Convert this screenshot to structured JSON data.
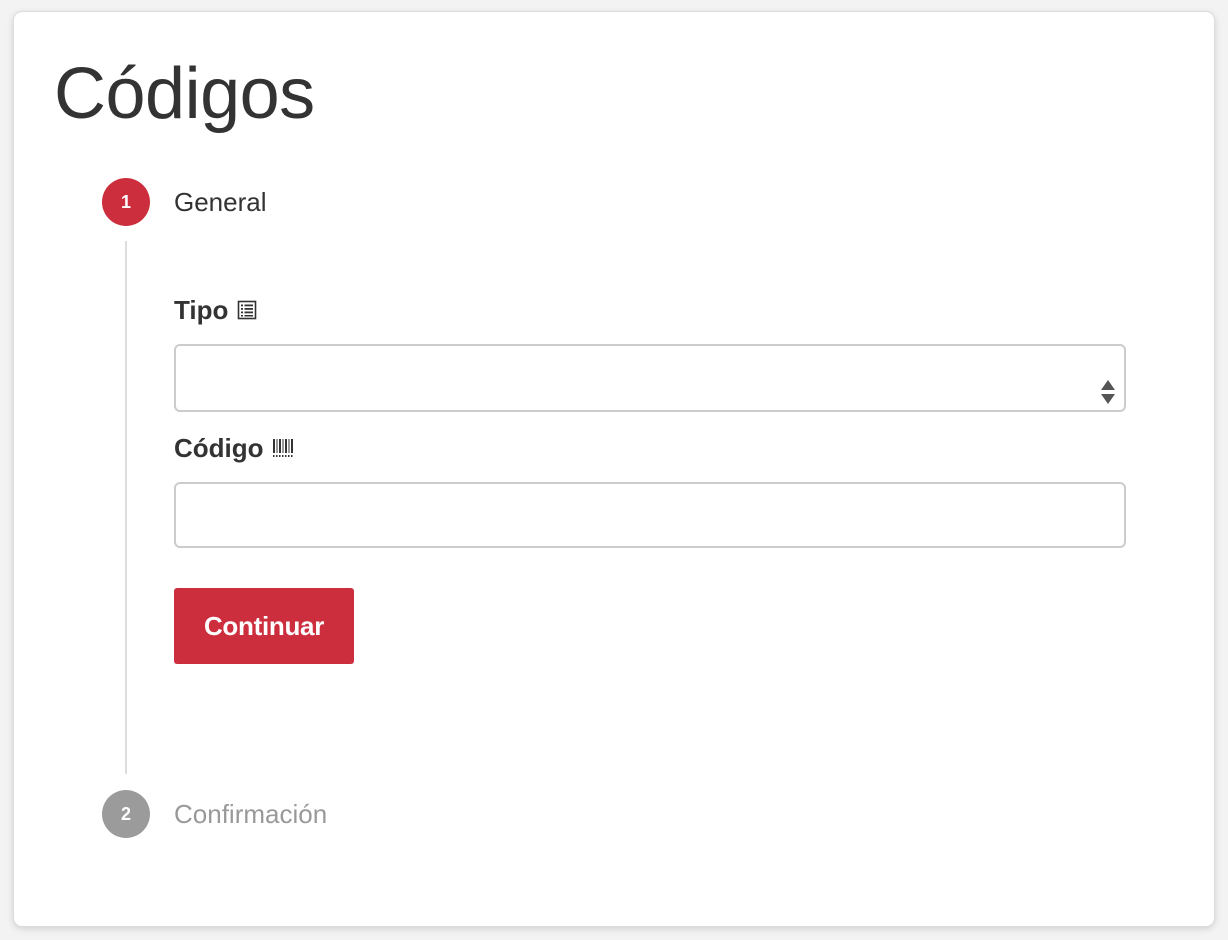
{
  "page": {
    "title": "Códigos"
  },
  "steps": [
    {
      "number": "1",
      "title": "General",
      "state": "active"
    },
    {
      "number": "2",
      "title": "Confirmación",
      "state": "inactive"
    }
  ],
  "form": {
    "tipo": {
      "label": "Tipo",
      "icon": "list-alt-icon",
      "selected_value": ""
    },
    "codigo": {
      "label": "Código",
      "icon": "barcode-icon",
      "value": "",
      "placeholder": ""
    },
    "continue_label": "Continuar"
  },
  "colors": {
    "accent": "#cc2e3d",
    "inactive_step": "#9b9b9b",
    "border": "#cccccc",
    "line": "#dddddd"
  }
}
